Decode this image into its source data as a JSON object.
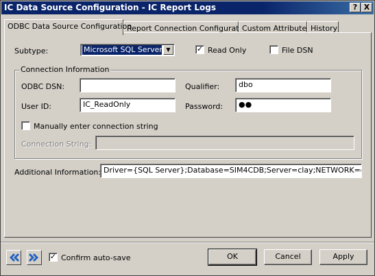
{
  "window": {
    "title": "IC Data Source Configuration - IC Report Logs",
    "help_label": "?",
    "close_label": "X"
  },
  "tabs": [
    {
      "label": "ODBC Data Source Configuration",
      "active": true
    },
    {
      "label": "Report Connection Configuration",
      "active": false
    },
    {
      "label": "Custom Attributes",
      "active": false
    },
    {
      "label": "History",
      "active": false
    }
  ],
  "form": {
    "subtype_label": "Subtype:",
    "subtype_value": "Microsoft SQL Server",
    "read_only_label": "Read Only",
    "read_only_checked": true,
    "file_dsn_label": "File DSN",
    "file_dsn_checked": false,
    "connection_group_label": "Connection Information",
    "odbc_dsn_label": "ODBC DSN:",
    "odbc_dsn_value": "",
    "qualifier_label": "Qualifier:",
    "qualifier_value": "dbo",
    "user_id_label": "User ID:",
    "user_id_value": "IC_ReadOnly",
    "password_label": "Password:",
    "password_value": "●●",
    "manual_conn_label": "Manually enter connection string",
    "manual_conn_checked": false,
    "conn_string_label": "Connection String:",
    "conn_string_value": "",
    "additional_info_label": "Additional Information:",
    "additional_info_value": "Driver={SQL Server};Database=SIM4CDB;Server=clay;NETWORK=dbmssocn"
  },
  "footer": {
    "confirm_autosave_label": "Confirm auto-save",
    "confirm_autosave_checked": true,
    "ok_label": "OK",
    "cancel_label": "Cancel",
    "apply_label": "Apply"
  },
  "colors": {
    "title_bar": "#0a246a",
    "face": "#d4d0c8",
    "nav_arrow": "#1f5fbf"
  },
  "icons": {
    "back": "double-chevron-left-icon",
    "forward": "double-chevron-right-icon"
  }
}
